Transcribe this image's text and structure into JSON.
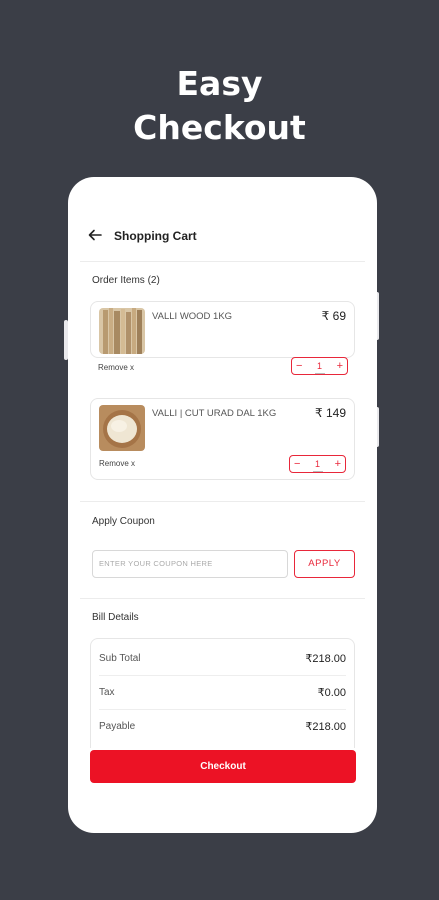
{
  "headline": {
    "line1": "Easy",
    "line2": "Checkout"
  },
  "header": {
    "title": "Shopping Cart"
  },
  "order": {
    "label": "Order Items (2)",
    "items": [
      {
        "name": "VALLI WOOD 1KG",
        "price": "₹ 69",
        "remove": "Remove x",
        "qty": "1",
        "minus": "−",
        "plus": "+"
      },
      {
        "name": "VALLI | CUT URAD DAL 1KG",
        "price": "₹ 149",
        "remove": "Remove x",
        "qty": "1",
        "minus": "−",
        "plus": "+"
      }
    ]
  },
  "coupon": {
    "label": "Apply Coupon",
    "placeholder": "ENTER YOUR COUPON HERE",
    "apply_label": "APPLY"
  },
  "bill": {
    "label": "Bill Details",
    "rows": [
      {
        "label": "Sub Total",
        "value": "₹218.00"
      },
      {
        "label": "Tax",
        "value": "₹0.00"
      },
      {
        "label": "Payable",
        "value": "₹218.00"
      }
    ]
  },
  "checkout_label": "Checkout",
  "colors": {
    "background": "#3b3e47",
    "accent": "#ec1225"
  }
}
